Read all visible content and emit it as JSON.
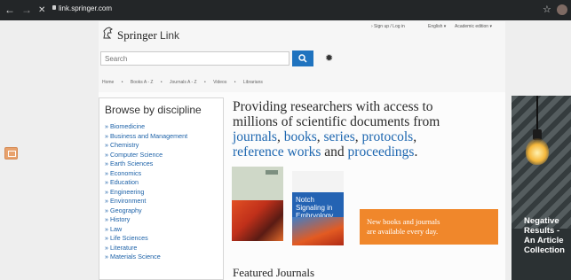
{
  "browser": {
    "back_icon": "←",
    "forward_icon": "→",
    "close_icon": "✕",
    "url": "link.springer.com",
    "star_icon": "☆"
  },
  "header": {
    "brand": "Springer",
    "brand_suffix": "Link",
    "signup": "› Sign up / Log in",
    "language": "English ▾",
    "edition": "Academic edition ▾"
  },
  "search": {
    "placeholder": "Search"
  },
  "breadcrumb": [
    "Home",
    "Books A - Z",
    "Journals A - Z",
    "Videos",
    "Librarians"
  ],
  "breadcrumb_sep": "•",
  "browse": {
    "title": "Browse by discipline",
    "items": [
      "» Biomedicine",
      "» Business and Management",
      "» Chemistry",
      "» Computer Science",
      "» Earth Sciences",
      "» Economics",
      "» Education",
      "» Engineering",
      "» Environment",
      "» Geography",
      "» History",
      "» Law",
      "» Life Sciences",
      "» Literature",
      "» Materials Science"
    ]
  },
  "hero": {
    "line1": "Providing researchers with access to",
    "line2": "millions of scientific documents from",
    "journals": "journals",
    "books": "books",
    "series": "series",
    "protocols": "protocols",
    "reference_works": "reference works",
    "and": "and",
    "proceedings": "proceedings",
    "comma": ","
  },
  "book2": {
    "title": "Notch Signaling in Embryology and Cancer"
  },
  "promo": {
    "line1": "New books and journals",
    "line2": "are available every day."
  },
  "featured": {
    "title": "Featured Journals"
  },
  "ad": {
    "line1": "Negative",
    "line2": "Results -",
    "line3": "An Article",
    "line4": "Collection"
  },
  "colors": {
    "accent": "#1f73bf",
    "promo": "#f0872b",
    "link": "#1d62a8"
  }
}
